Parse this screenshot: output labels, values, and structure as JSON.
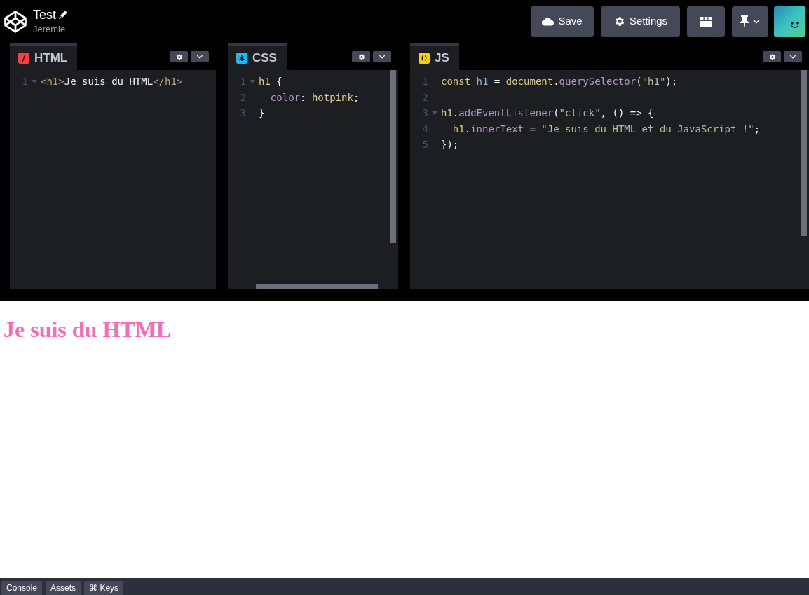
{
  "header": {
    "title": "Test",
    "author": "Jeremie",
    "buttons": [
      {
        "kind": "save",
        "label": "Save"
      },
      {
        "kind": "settings",
        "label": "Settings"
      },
      {
        "kind": "layout"
      },
      {
        "kind": "pin"
      }
    ]
  },
  "editors": [
    {
      "kind": "html",
      "label": "HTML",
      "color": "#ff3c41",
      "scroll_vertical": false,
      "scroll_horizontal": false,
      "lines": [
        {
          "number": "1",
          "foldable": true,
          "tokens": [
            {
              "kind": "tag",
              "text": "<h1>"
            },
            {
              "kind": "plain",
              "text": "Je suis du HTML"
            },
            {
              "kind": "tag",
              "text": "</h1>"
            }
          ]
        }
      ]
    },
    {
      "kind": "css",
      "label": "CSS",
      "color": "#0ebeff",
      "scroll_vertical": true,
      "scroll_horizontal": true,
      "lines": [
        {
          "number": "1",
          "foldable": true,
          "tokens": [
            {
              "kind": "keyword",
              "text": "h1"
            },
            {
              "kind": "plain",
              "text": " {"
            }
          ]
        },
        {
          "number": "2",
          "foldable": false,
          "tokens": [
            {
              "kind": "property",
              "text": "  color"
            },
            {
              "kind": "plain",
              "text": ": "
            },
            {
              "kind": "keyword",
              "text": "hotpink"
            },
            {
              "kind": "plain",
              "text": ";"
            }
          ]
        },
        {
          "number": "3",
          "foldable": false,
          "tokens": [
            {
              "kind": "plain",
              "text": "}"
            }
          ]
        }
      ]
    },
    {
      "kind": "js",
      "label": "JS",
      "color": "#fcd000",
      "scroll_vertical": true,
      "scroll_horizontal": false,
      "lines": [
        {
          "number": "1",
          "foldable": false,
          "tokens": [
            {
              "kind": "keyword",
              "text": "const "
            },
            {
              "kind": "variable",
              "text": "h1"
            },
            {
              "kind": "plain",
              "text": " = "
            },
            {
              "kind": "keyword",
              "text": "document"
            },
            {
              "kind": "plain",
              "text": "."
            },
            {
              "kind": "property",
              "text": "querySelector"
            },
            {
              "kind": "plain",
              "text": "("
            },
            {
              "kind": "string",
              "text": "\"h1\""
            },
            {
              "kind": "plain",
              "text": ");"
            }
          ]
        },
        {
          "number": "2",
          "foldable": false
        },
        {
          "number": "3",
          "foldable": true,
          "tokens": [
            {
              "kind": "keyword",
              "text": "h1"
            },
            {
              "kind": "plain",
              "text": "."
            },
            {
              "kind": "property",
              "text": "addEventListener"
            },
            {
              "kind": "plain",
              "text": "("
            },
            {
              "kind": "string",
              "text": "\"click\""
            },
            {
              "kind": "plain",
              "text": ", () => {"
            }
          ]
        },
        {
          "number": "4",
          "foldable": false,
          "tokens": [
            {
              "kind": "keyword",
              "text": "  h1"
            },
            {
              "kind": "plain",
              "text": "."
            },
            {
              "kind": "property",
              "text": "innerText"
            },
            {
              "kind": "plain",
              "text": " = "
            },
            {
              "kind": "string",
              "text": "\"Je suis du HTML et du JavaScript !\""
            },
            {
              "kind": "plain",
              "text": ";"
            }
          ]
        },
        {
          "number": "5",
          "foldable": false,
          "tokens": [
            {
              "kind": "plain",
              "text": "});"
            }
          ]
        }
      ]
    }
  ],
  "preview": {
    "heading": "Je suis du HTML"
  },
  "footer": {
    "buttons": [
      "Console",
      "Assets",
      "⌘ Keys"
    ]
  }
}
